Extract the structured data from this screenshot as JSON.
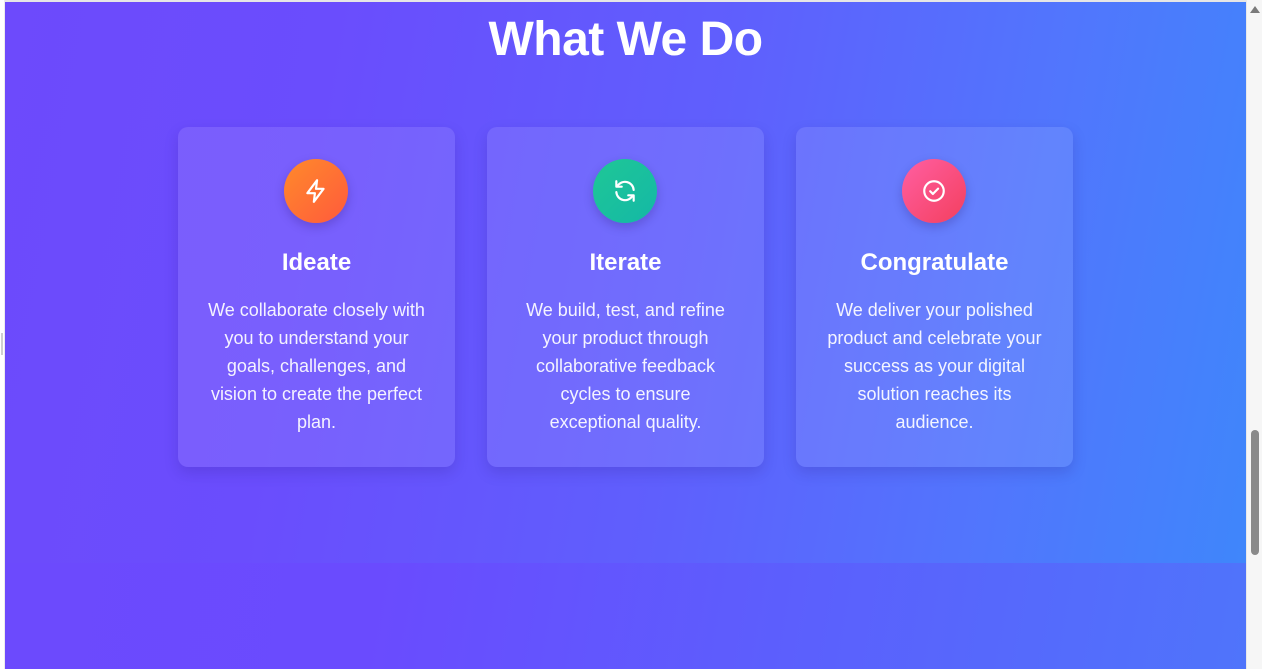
{
  "section": {
    "title": "What We Do"
  },
  "cards": [
    {
      "icon": "lightning-icon",
      "icon_gradient": [
        "#ff8a2b",
        "#ff5a3c"
      ],
      "title": "Ideate",
      "text": "We collaborate closely with you to understand your goals, challenges, and vision to create the perfect plan."
    },
    {
      "icon": "refresh-icon",
      "icon_gradient": [
        "#1fc796",
        "#14b8a6"
      ],
      "title": "Iterate",
      "text": "We build, test, and refine your product through collaborative feedback cycles to ensure exceptional quality."
    },
    {
      "icon": "check-circle-icon",
      "icon_gradient": [
        "#ff5fa2",
        "#f43f5e"
      ],
      "title": "Congratulate",
      "text": "We deliver your polished product and celebrate your success as your digital solution reaches its audience."
    }
  ],
  "colors": {
    "gradient_start": "#6d4afc",
    "gradient_end": "#3f86fb",
    "text": "#ffffff"
  }
}
